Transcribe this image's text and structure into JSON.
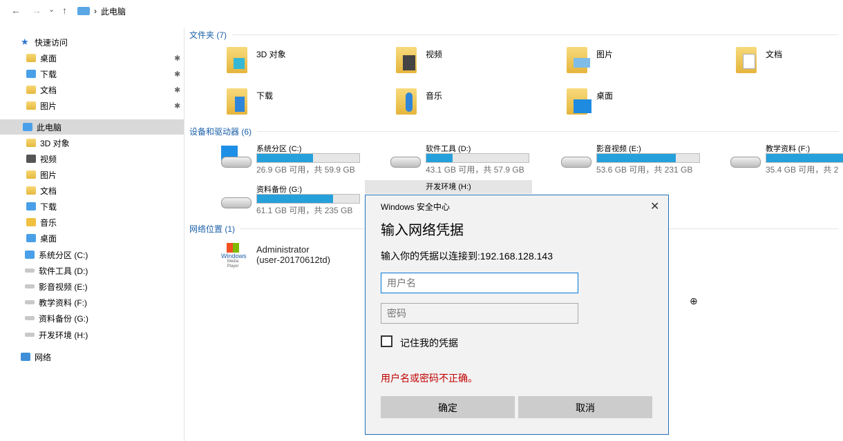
{
  "nav": {
    "back": "←",
    "forward": "→",
    "recent": "⌄",
    "up": "↑",
    "crumb_sep": "›",
    "location": "此电脑"
  },
  "sidebar": {
    "quick_access": "快速访问",
    "quick": [
      "桌面",
      "下载",
      "文档",
      "图片"
    ],
    "this_pc": "此电脑",
    "pc_items": [
      "3D 对象",
      "视频",
      "图片",
      "文档",
      "下载",
      "音乐",
      "桌面"
    ],
    "drives": [
      "系统分区 (C:)",
      "软件工具 (D:)",
      "影音视频 (E:)",
      "教学资料 (F:)",
      "资料备份 (G:)",
      "开发环境 (H:)"
    ],
    "network": "网络"
  },
  "groups": {
    "folders": "文件夹 (7)",
    "drives": "设备和驱动器 (6)",
    "network": "网络位置 (1)"
  },
  "folders": [
    {
      "name": "3D 对象"
    },
    {
      "name": "视频"
    },
    {
      "name": "图片"
    },
    {
      "name": "文档"
    },
    {
      "name": "下载"
    },
    {
      "name": "音乐"
    },
    {
      "name": "桌面"
    }
  ],
  "drives": [
    {
      "name": "系统分区 (C:)",
      "info": "26.9 GB 可用，共 59.9 GB",
      "used": 0.55
    },
    {
      "name": "软件工具 (D:)",
      "info": "43.1 GB 可用，共 57.9 GB",
      "used": 0.26
    },
    {
      "name": "影音视频 (E:)",
      "info": "53.6 GB 可用，共 231 GB",
      "used": 0.77
    },
    {
      "name": "教学资料 (F:)",
      "info": "35.4 GB 可用，共 2",
      "used": 0.9
    },
    {
      "name": "资料备份 (G:)",
      "info": "61.1 GB 可用，共 235 GB",
      "used": 0.74
    },
    {
      "name": "开发环境 (H:)"
    }
  ],
  "network_item": {
    "line1": "Administrator",
    "line2": "(user-20170612td)",
    "logo_text": "Windows",
    "logo_sub": "Media Player"
  },
  "dialog": {
    "title": "Windows 安全中心",
    "close": "✕",
    "heading": "输入网络凭据",
    "message": "输入你的凭据以连接到:192.168.128.143",
    "username_placeholder": "用户名",
    "password_placeholder": "密码",
    "remember": "记住我的凭据",
    "error": "用户名或密码不正确。",
    "ok": "确定",
    "cancel": "取消"
  },
  "colors": {
    "accent": "#0078d7",
    "error": "#c00000",
    "bar_fill": "#26a0da"
  }
}
